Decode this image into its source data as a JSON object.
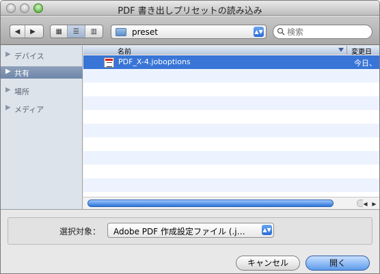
{
  "window": {
    "title": "PDF 書き出しプリセットの読み込み"
  },
  "toolbar": {
    "back_icon": "◀",
    "forward_icon": "▶",
    "icon_view": "▦",
    "list_view": "☰",
    "column_view": "▥",
    "path_label": "preset",
    "search_placeholder": "検索"
  },
  "sidebar": {
    "items": [
      {
        "label": "デバイス",
        "selected": false
      },
      {
        "label": "共有",
        "selected": true
      },
      {
        "label": "場所",
        "selected": false
      },
      {
        "label": "メディア",
        "selected": false
      }
    ]
  },
  "files": {
    "header_name": "名前",
    "header_date": "変更日",
    "selected": {
      "name": "PDF_X-4.joboptions",
      "date": "今日、"
    }
  },
  "bottom": {
    "format_label": "選択対象：",
    "format_value": "Adobe PDF 作成設定ファイル (.j…",
    "cancel_label": "キャンセル",
    "open_label": "開く"
  }
}
